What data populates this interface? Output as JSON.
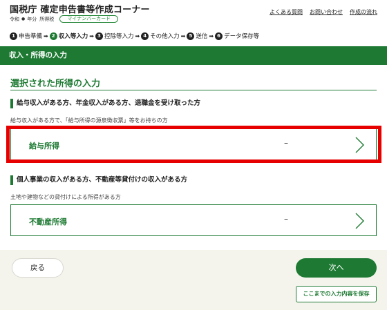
{
  "header": {
    "title": "国税庁 確定申告書等作成コーナー",
    "era": "令和",
    "year_suffix": "年分",
    "tax_type": "所得税",
    "badge": "マイナンバーカード",
    "links": [
      "よくある質問",
      "お問い合わせ",
      "作成の流れ"
    ]
  },
  "steps": [
    {
      "num": "1",
      "label": "申告準備",
      "active": false
    },
    {
      "num": "2",
      "label": "収入等入力",
      "active": true
    },
    {
      "num": "3",
      "label": "控除等入力",
      "active": false
    },
    {
      "num": "4",
      "label": "その他入力",
      "active": false
    },
    {
      "num": "5",
      "label": "送信",
      "active": false
    },
    {
      "num": "6",
      "label": "データ保存等",
      "active": false
    }
  ],
  "page": {
    "bar_title": "収入・所得の入力",
    "section_title": "選択された所得の入力"
  },
  "groups": [
    {
      "heading": "給与収入がある方、年金収入がある方、退職金を受け取った方",
      "description": "給与収入がある方で、「給与所得の源泉徴収票」等をお持ちの方",
      "card": {
        "label": "給与所得",
        "value": "–"
      }
    },
    {
      "heading": "個人事業の収入がある方、不動産等貸付けの収入がある方",
      "description": "土地や建物などの貸付けによる所得がある方",
      "card": {
        "label": "不動産所得",
        "value": "–"
      }
    }
  ],
  "footer": {
    "back_label": "戻る",
    "next_label": "次へ",
    "save_label": "ここまでの入力内容を保存"
  },
  "colors": {
    "primary_green": "#1e7a33",
    "highlight_red": "#e60000",
    "footer_bg": "#f4f4ec"
  }
}
